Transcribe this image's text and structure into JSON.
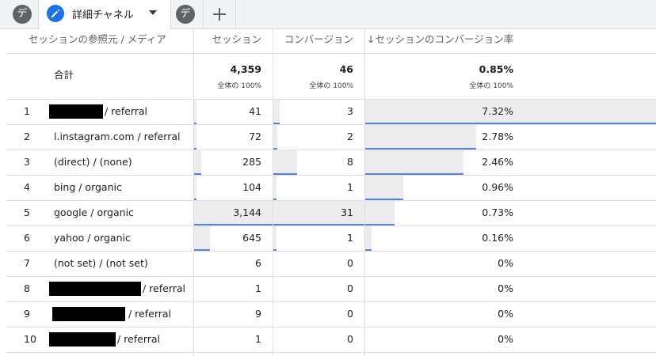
{
  "tabs": [
    {
      "label": "デ",
      "type": "chip"
    },
    {
      "label": "詳細チャネル",
      "type": "active"
    },
    {
      "label": "デ",
      "type": "chip"
    }
  ],
  "columns": {
    "dimension": "セッションの参照元 / メディア",
    "sessions": "セッション",
    "conversions": "コンバージョン",
    "rate": "↓セッションのコンバージョン率"
  },
  "totals": {
    "label": "合計",
    "sessions": "4,359",
    "sessions_sub": "全体の 100%",
    "conversions": "46",
    "conversions_sub": "全体の 100%",
    "rate": "0.85%",
    "rate_sub": "全体の 100%"
  },
  "rows": [
    {
      "index": "1",
      "source": "/ referral",
      "redacted": true,
      "sessions": "41",
      "sessions_share": 0.013,
      "conversions": "3",
      "conversions_share": 0.065,
      "rate": "7.32%",
      "rate_value": 7.32
    },
    {
      "index": "2",
      "source": "l.instagram.com / referral",
      "redacted": false,
      "sessions": "72",
      "sessions_share": 0.023,
      "conversions": "2",
      "conversions_share": 0.043,
      "rate": "2.78%",
      "rate_value": 2.78
    },
    {
      "index": "3",
      "source": "(direct) / (none)",
      "redacted": false,
      "sessions": "285",
      "sessions_share": 0.091,
      "conversions": "8",
      "conversions_share": 0.258,
      "rate": "2.46%",
      "rate_value": 2.46
    },
    {
      "index": "4",
      "source": "bing / organic",
      "redacted": false,
      "sessions": "104",
      "sessions_share": 0.033,
      "conversions": "1",
      "conversions_share": 0.032,
      "rate": "0.96%",
      "rate_value": 0.96
    },
    {
      "index": "5",
      "source": "google / organic",
      "redacted": false,
      "sessions": "3,144",
      "sessions_share": 1.0,
      "conversions": "31",
      "conversions_share": 1.0,
      "rate": "0.73%",
      "rate_value": 0.73
    },
    {
      "index": "6",
      "source": "yahoo / organic",
      "redacted": false,
      "sessions": "645",
      "sessions_share": 0.205,
      "conversions": "1",
      "conversions_share": 0.032,
      "rate": "0.16%",
      "rate_value": 0.16
    },
    {
      "index": "7",
      "source": "(not set) / (not set)",
      "redacted": false,
      "sessions": "6",
      "sessions_share": 0,
      "conversions": "0",
      "conversions_share": 0,
      "rate": "0%",
      "rate_value": 0
    },
    {
      "index": "8",
      "source": "/ referral",
      "redacted": true,
      "sessions": "1",
      "sessions_share": 0,
      "conversions": "0",
      "conversions_share": 0,
      "rate": "0%",
      "rate_value": 0
    },
    {
      "index": "9",
      "source": "/ referral",
      "redacted": true,
      "sessions": "9",
      "sessions_share": 0,
      "conversions": "0",
      "conversions_share": 0,
      "rate": "0%",
      "rate_value": 0
    },
    {
      "index": "10",
      "source": "/ referral",
      "redacted": true,
      "sessions": "1",
      "sessions_share": 0,
      "conversions": "0",
      "conversions_share": 0,
      "rate": "0%",
      "rate_value": 0
    }
  ],
  "colors": {
    "bar_fill": "#ececec",
    "bar_line": "#4a86e8",
    "accent": "#1a73e8"
  }
}
